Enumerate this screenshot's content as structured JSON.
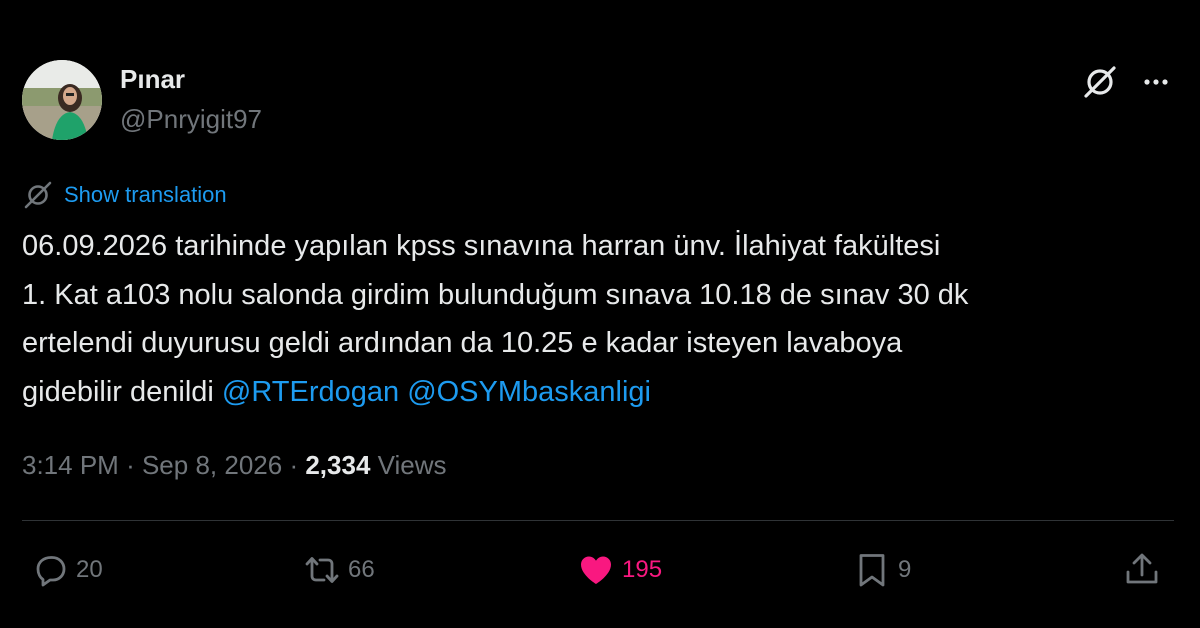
{
  "author": {
    "display_name": "Pınar",
    "handle": "@Pnryigit97"
  },
  "header_icons": {
    "grok": "grok-icon",
    "more": "more-icon"
  },
  "translation": {
    "icon": "translate-icon",
    "link_label": "Show translation"
  },
  "tweet": {
    "lines": [
      "06.09.2026 tarihinde yapılan kpss sınavına harran ünv. İlahiyat fakültesi",
      "1. Kat a103 nolu salonda girdim bulunduğum sınava 10.18 de sınav 30 dk",
      "ertelendi duyurusu geldi ardından da 10.25 e kadar isteyen lavaboya"
    ],
    "last_line_text": "gidebilir denildi",
    "mentions": [
      "@RTErdogan",
      "@OSYMbaskanligi"
    ]
  },
  "meta": {
    "time": "3:14 PM",
    "separator": "·",
    "date": "Sep 8, 2026",
    "views_count": "2,334",
    "views_label": "Views"
  },
  "actions": {
    "reply": {
      "icon": "reply-icon",
      "count": "20"
    },
    "retweet": {
      "icon": "retweet-icon",
      "count": "66"
    },
    "like": {
      "icon": "heart-icon",
      "count": "195",
      "liked": true
    },
    "bookmark": {
      "icon": "bookmark-icon",
      "count": "9"
    },
    "share": {
      "icon": "share-icon"
    }
  },
  "colors": {
    "background": "#000000",
    "text_primary": "#e7e9ea",
    "text_secondary": "#71767b",
    "accent_blue": "#1d9bf0",
    "like_pink": "#f91880",
    "divider": "#2f3336"
  }
}
